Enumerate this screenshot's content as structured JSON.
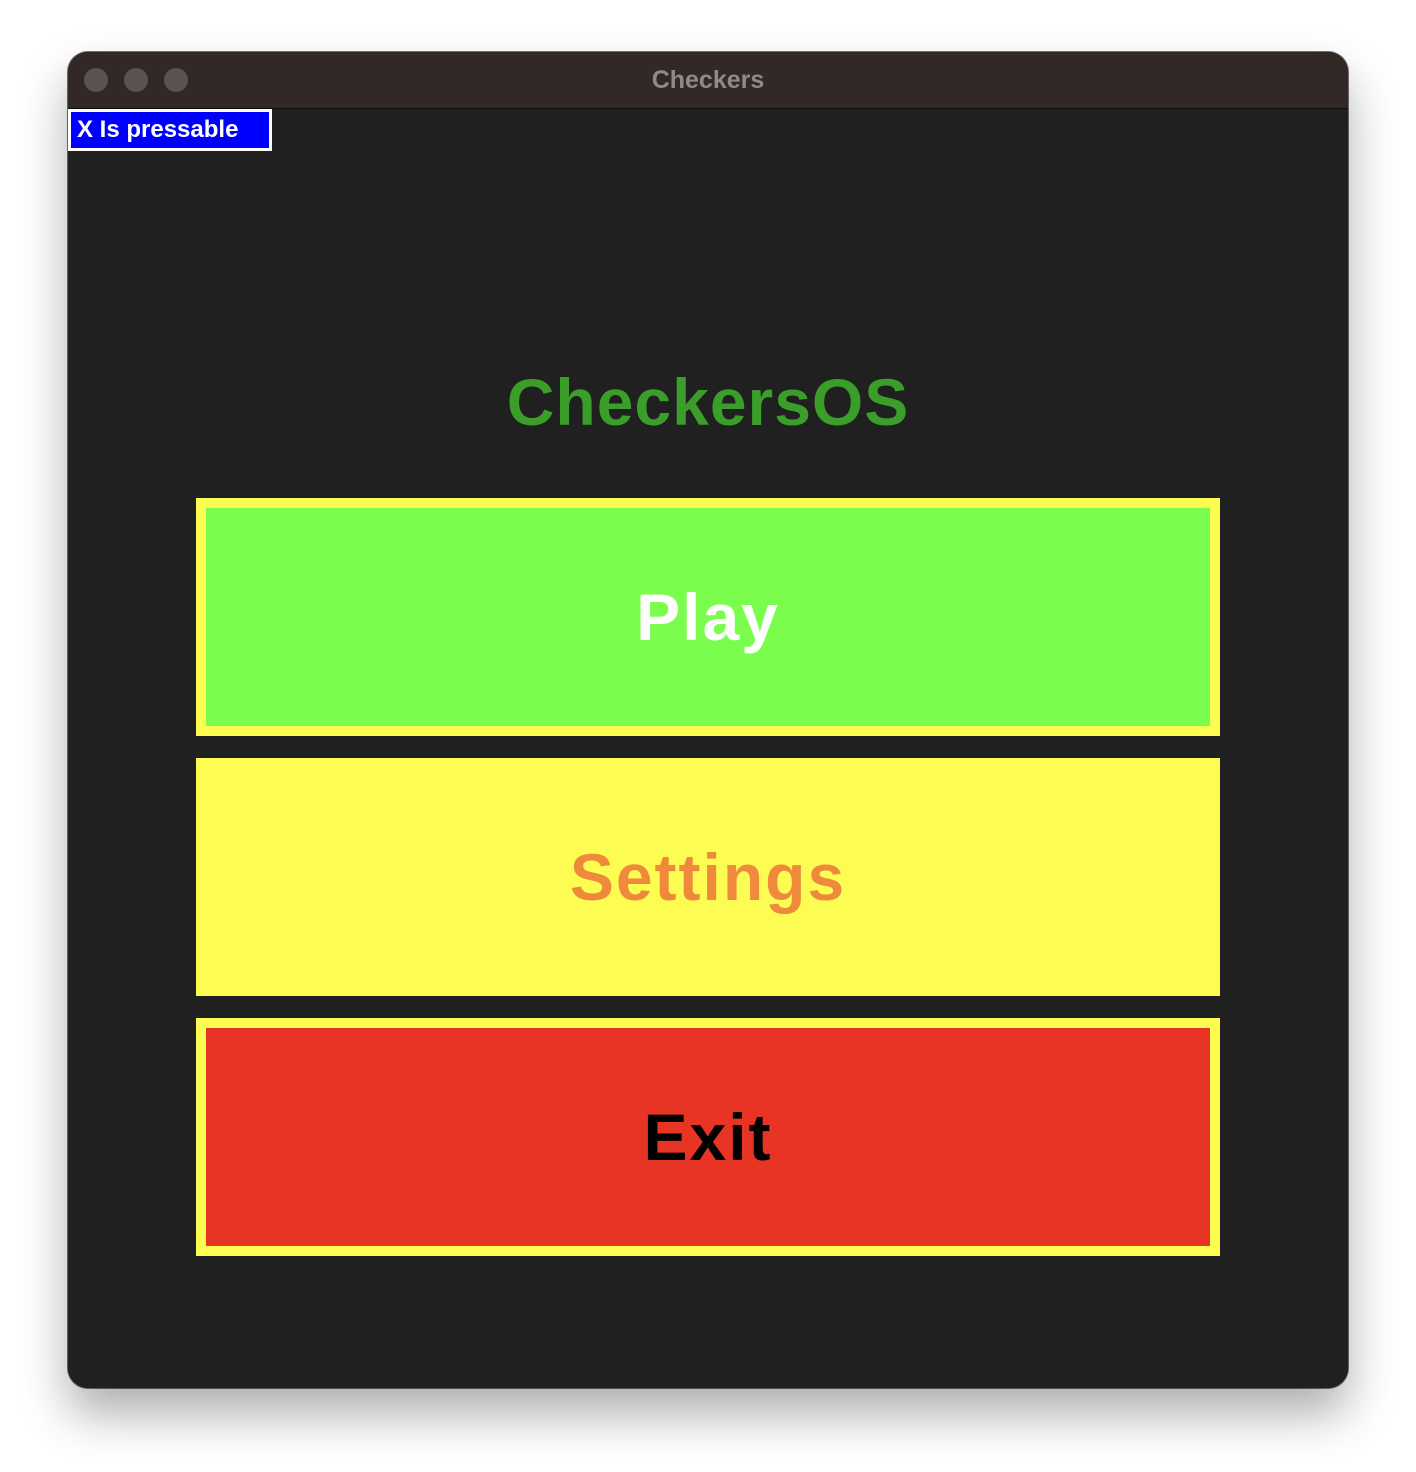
{
  "window": {
    "title": "Checkers"
  },
  "hint": {
    "text": "X Is pressable"
  },
  "app": {
    "title": "CheckersOS"
  },
  "menu": {
    "play_label": "Play",
    "settings_label": "Settings",
    "exit_label": "Exit"
  },
  "colors": {
    "background": "#202020",
    "titlebar": "#322826",
    "title_text": "#3b9d2a",
    "play_fill": "#7afd4d",
    "button_border": "#fdfc52",
    "settings_fill": "#fdfc52",
    "settings_text": "#ef8a3c",
    "exit_fill": "#e83424",
    "hint_fill": "#0000ff"
  }
}
